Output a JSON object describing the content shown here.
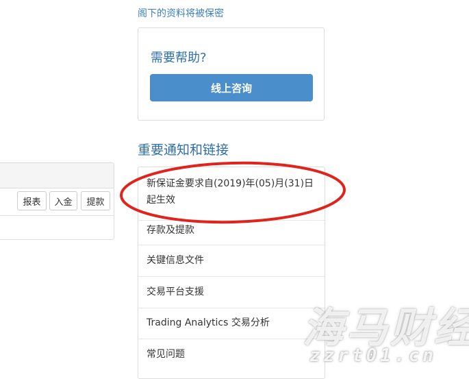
{
  "privacy_note": "阁下的资料将被保密",
  "help": {
    "title": "需要帮助?",
    "button_label": "线上咨询"
  },
  "notices": {
    "heading": "重要通知和链接",
    "items": [
      "新保证金要求自(2019)年(05)月(31)日起生效",
      "存款及提款",
      "关键信息文件",
      "交易平台支援",
      "Trading Analytics 交易分析",
      "常见问题"
    ]
  },
  "account_actions": {
    "report_label": "报表",
    "deposit_label": "入金",
    "withdraw_label": "提款"
  },
  "watermark": {
    "brand": "海马财经",
    "url": "zzrt01.cn"
  },
  "colors": {
    "link_blue": "#3b7fc1",
    "heading_blue": "#2f6fa8",
    "button_blue": "#4a8fcb",
    "annotation_red": "#e0241c"
  }
}
